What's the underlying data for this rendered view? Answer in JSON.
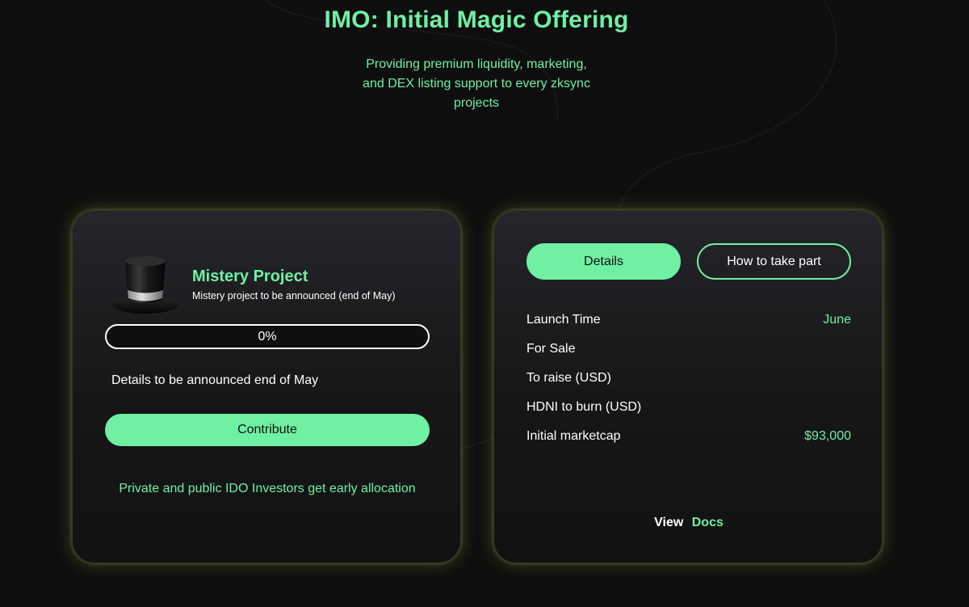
{
  "hero": {
    "title": "IMO: Initial Magic Offering",
    "subtitle": "Providing premium liquidity, marketing, and DEX listing support to every zksync projects"
  },
  "project": {
    "icon": "top-hat-icon",
    "name": "Mistery Project",
    "description": "Mistery project to be announced (end of May)",
    "progress_percent": 0,
    "progress_label": "0%",
    "announcement": "Details to be announced end of May",
    "contribute_label": "Contribute",
    "note": "Private and public IDO Investors get early allocation"
  },
  "tabs": {
    "details_label": "Details",
    "how_to_label": "How to take part",
    "active": "Details"
  },
  "details": [
    {
      "label": "Launch Time",
      "value": "June"
    },
    {
      "label": "For Sale",
      "value": ""
    },
    {
      "label": "To raise (USD)",
      "value": ""
    },
    {
      "label": "HDNI to burn (USD)",
      "value": ""
    },
    {
      "label": "Initial marketcap",
      "value": "$93,000"
    }
  ],
  "docs": {
    "view_label": "View",
    "link_label": "Docs"
  },
  "colors": {
    "accent": "#6ff0a3",
    "background": "#0e0e0e",
    "card_glow": "#c8d25a"
  }
}
